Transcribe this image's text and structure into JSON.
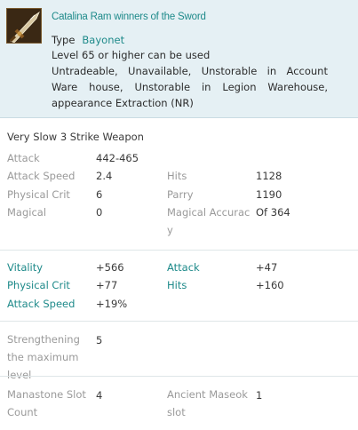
{
  "item": {
    "name": "Catalina Ram winners of the Sword",
    "type_label": "Type",
    "type_value": "Bayonet",
    "level_requirement": "Level 65 or higher can be used",
    "restrictions": "Untradeable, Unavailable, Unstorable in Account Ware house, Unstorable in Legion Warehouse, appearance Extraction (NR)",
    "icon": "sword-icon"
  },
  "weapon_class": "Very Slow 3 Strike Weapon",
  "base_stats": {
    "attack": {
      "label": "Attack",
      "value": "442-465"
    },
    "attack_speed": {
      "label": "Attack Speed",
      "value": "2.4"
    },
    "hits": {
      "label": "Hits",
      "value": "1128"
    },
    "physical_crit": {
      "label": "Physical Crit",
      "value": "6"
    },
    "parry": {
      "label": "Parry",
      "value": "1190"
    },
    "magical": {
      "label": "Magical",
      "value": "0"
    },
    "magical_accuracy": {
      "label": "Magical Accurac y",
      "value": "Of 364"
    }
  },
  "bonus_stats": {
    "vitality": {
      "label": "Vitality",
      "value": "+566"
    },
    "attack": {
      "label": "Attack",
      "value": "+47"
    },
    "physical_crit": {
      "label": "Physical Crit",
      "value": "+77"
    },
    "hits": {
      "label": "Hits",
      "value": "+160"
    },
    "attack_speed": {
      "label": "Attack Speed",
      "value": "+19%"
    }
  },
  "enchant": {
    "label": "Strengthening the maximum level",
    "value": "5"
  },
  "slots": {
    "manastone": {
      "label": "Manastone Slot Count",
      "value": "4"
    },
    "maseok": {
      "label": "Ancient Maseok slot",
      "value": "1"
    }
  },
  "colors": {
    "header_bg": "#e5f0f4",
    "accent_teal": "#1e8a8a",
    "label_gray": "#9a9a9a"
  }
}
